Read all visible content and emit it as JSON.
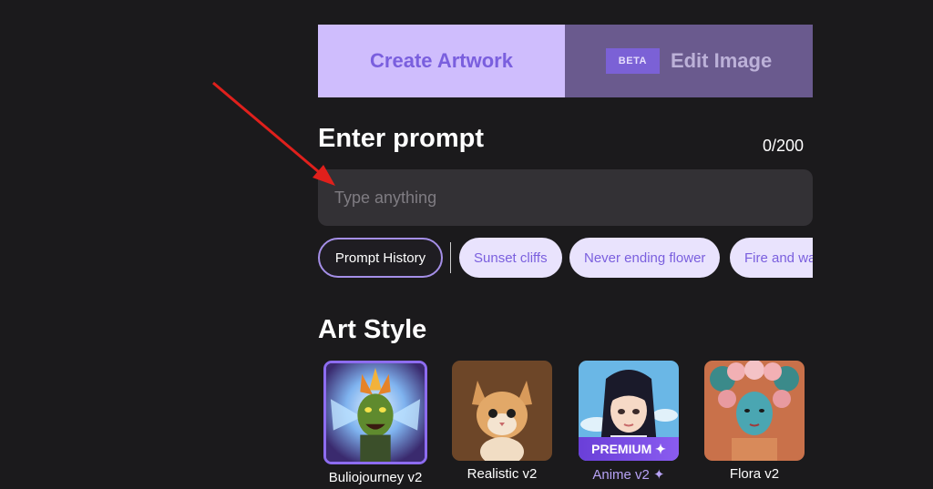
{
  "tabs": {
    "create_label": "Create Artwork",
    "edit_label": "Edit Image",
    "beta_badge": "BETA"
  },
  "prompt": {
    "title": "Enter prompt",
    "count": "0/200",
    "placeholder": "Type anything",
    "value": ""
  },
  "chips": {
    "history_label": "Prompt History",
    "suggestions": [
      "Sunset cliffs",
      "Never ending flower",
      "Fire and wa"
    ]
  },
  "art_style": {
    "title": "Art Style",
    "styles": [
      {
        "label": "Buliojourney v2",
        "selected": true,
        "premium": false
      },
      {
        "label": "Realistic v2",
        "selected": false,
        "premium": false
      },
      {
        "label": "Anime v2 ✦",
        "selected": false,
        "premium": true,
        "badge": "PREMIUM ✦"
      },
      {
        "label": "Flora v2",
        "selected": false,
        "premium": false
      }
    ]
  },
  "colors": {
    "background": "#1b1a1c",
    "tab_active": "#cfbdfd",
    "tab_inactive": "#6a5a8e",
    "accent": "#7a5fde",
    "annotation_arrow": "#e0201c"
  }
}
